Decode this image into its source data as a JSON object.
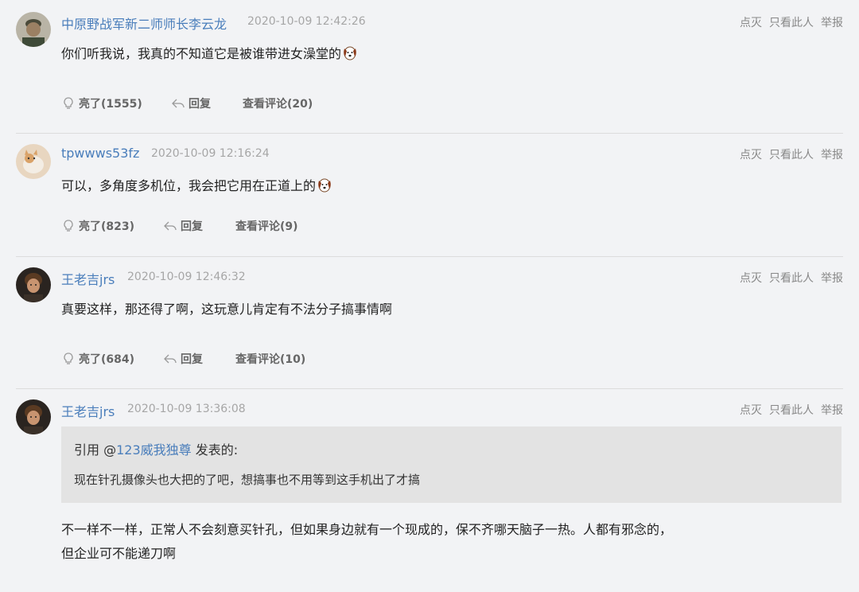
{
  "common": {
    "dislike_label": "点灭",
    "only_this_label": "只看此人",
    "report_label": "举报",
    "reply_label": "回复"
  },
  "comments": [
    {
      "username": "中原野战军新二师师长李云龙",
      "time": "2020-10-09 12:42:26",
      "content": "你们听我说，我真的不知道它是被谁带进女澡堂的",
      "emoji": "dog-face-emoji",
      "like_label": "亮了(1555)",
      "view_comments_label": "查看评论(20)"
    },
    {
      "username": "tpwwws53fz",
      "time": "2020-10-09 12:16:24",
      "content": "可以，多角度多机位，我会把它用在正道上的",
      "emoji": "dog-face-emoji",
      "like_label": "亮了(823)",
      "view_comments_label": "查看评论(9)"
    },
    {
      "username": "王老吉jrs",
      "time": "2020-10-09 12:46:32",
      "content": "真要这样，那还得了啊，这玩意儿肯定有不法分子搞事情啊",
      "like_label": "亮了(684)",
      "view_comments_label": "查看评论(10)"
    },
    {
      "username": "王老吉jrs",
      "time": "2020-10-09 13:36:08",
      "quote": {
        "prefix": "引用 @",
        "mention": "123威我独尊",
        "suffix": " 发表的:",
        "body": "现在针孔摄像头也大把的了吧，想搞事也不用等到这手机出了才搞"
      },
      "content_line1": "不一样不一样，正常人不会刻意买针孔，但如果身边就有一个现成的，保不齐哪天脑子一热。人都有邪念的，",
      "content_line2": "但企业可不能递刀啊"
    }
  ]
}
